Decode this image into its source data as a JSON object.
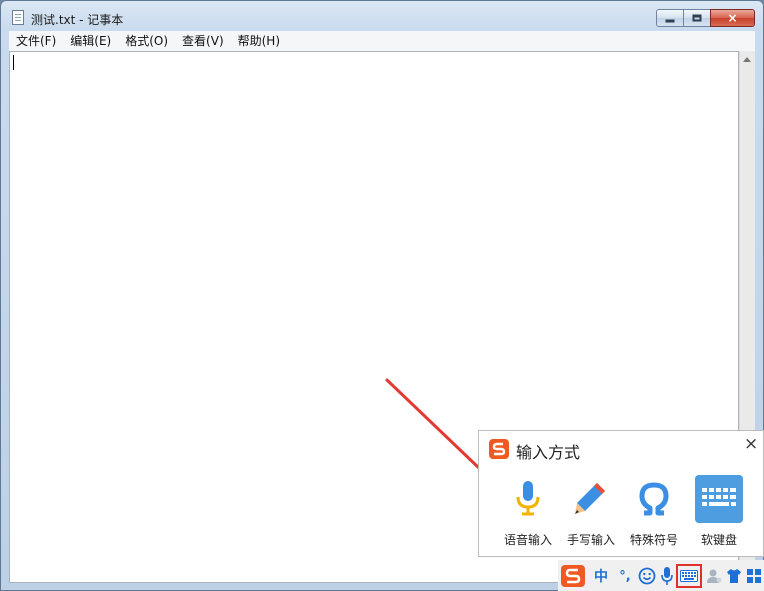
{
  "window": {
    "title": "测试.txt - 记事本",
    "buttons": {
      "minimize": "minimize",
      "maximize": "maximize",
      "close": "×"
    }
  },
  "menu": [
    "文件(F)",
    "编辑(E)",
    "格式(O)",
    "查看(V)",
    "帮助(H)"
  ],
  "editor": {
    "content": ""
  },
  "ime_popup": {
    "title": "输入方式",
    "close": "×",
    "tools": [
      {
        "label": "语音输入",
        "icon": "microphone-icon",
        "color": "#f0b400"
      },
      {
        "label": "手写输入",
        "icon": "pen-icon",
        "color": "#3a8fe3"
      },
      {
        "label": "特殊符号",
        "icon": "omega-icon",
        "color": "#3a8fe3"
      },
      {
        "label": "软键盘",
        "icon": "keyboard-icon",
        "color": "#4d9de0"
      }
    ]
  },
  "ime_status": {
    "mode": "中",
    "punct": "°,",
    "accent": "#1e6fd6",
    "highlight": "#e0302a"
  },
  "colors": {
    "sogou_orange": "#f05a22",
    "arrow_red": "#e23a33"
  }
}
